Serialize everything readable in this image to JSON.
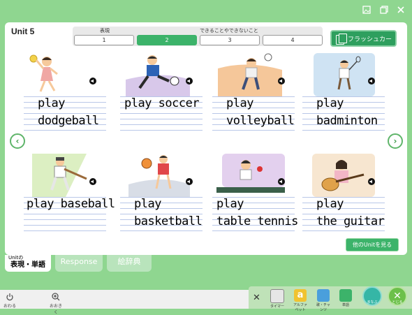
{
  "window": {
    "icons": [
      "image-icon",
      "restore-icon",
      "close-icon"
    ]
  },
  "header": {
    "unit_title": "Unit 5",
    "group1_label": "表現",
    "group1_ruby": "ひょうげん",
    "group2_label": "できることやできないこと",
    "pages": [
      "1",
      "2",
      "3",
      "4"
    ],
    "active_page": "2",
    "flashcard_label": "フラッシュカード"
  },
  "cards": [
    {
      "line1": "play",
      "line2": "dodgeball"
    },
    {
      "line1": "play soccer",
      "line2": ""
    },
    {
      "line1": "play",
      "line2": "volleyball"
    },
    {
      "line1": "play",
      "line2": "badminton"
    },
    {
      "line1": "play baseball",
      "line2": ""
    },
    {
      "line1": "play",
      "line2": "basketball"
    },
    {
      "line1": "play",
      "line2": "table tennis"
    },
    {
      "line1": "play",
      "line2": "the guitar"
    }
  ],
  "other_units_label": "他のUnitを見る",
  "bottom_tabs": {
    "tab1_small": "Unitの",
    "tab1_main": "表現・単語",
    "tab2": "Response",
    "tab3": "絵辞典"
  },
  "toolbar": {
    "end_label": "おわる",
    "zoom_label": "おおきく",
    "tray": [
      "タイマー",
      "アルファベット",
      "歌・チャンツ",
      "単語",
      "まなぶ",
      "とじる"
    ]
  },
  "colors": {
    "accent": "#3cb36a",
    "background": "#8fd690"
  }
}
